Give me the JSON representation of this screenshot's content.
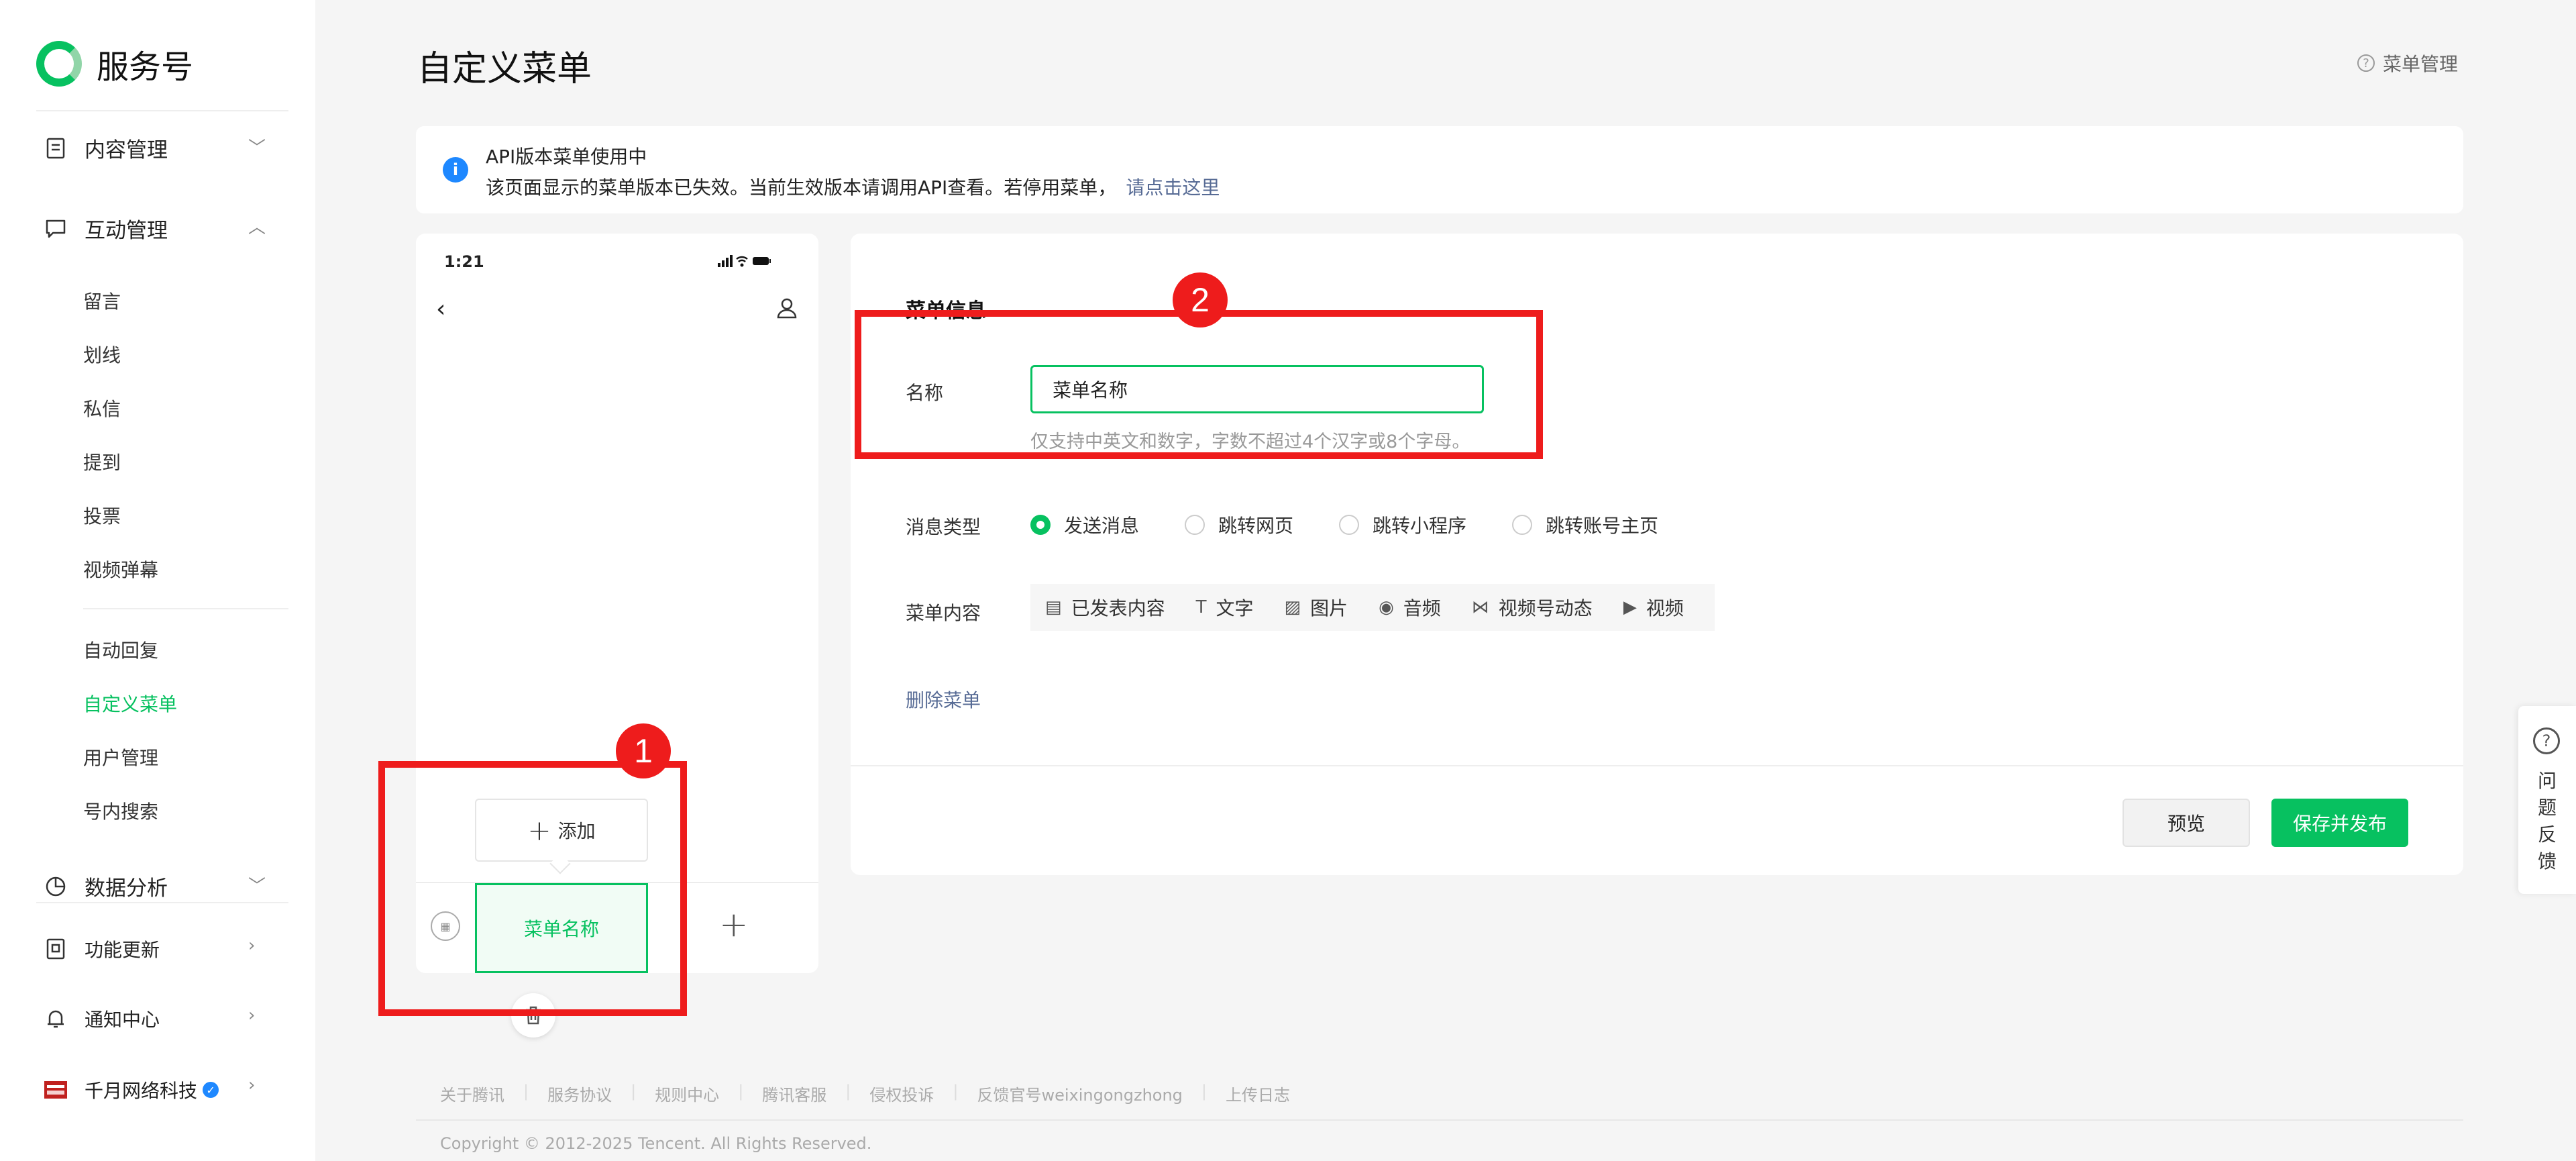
{
  "brand": {
    "name": "服务号"
  },
  "sidebar": {
    "content_mgmt": "内容管理",
    "interaction": "互动管理",
    "interaction_items": [
      "留言",
      "划线",
      "私信",
      "提到",
      "投票",
      "视频弹幕"
    ],
    "reply_items": [
      "自动回复",
      "自定义菜单",
      "用户管理",
      "号内搜索"
    ],
    "active_item": "自定义菜单",
    "data_analysis": "数据分析",
    "feature_updates": "功能更新",
    "notifications": "通知中心",
    "account_name": "千月网络科技"
  },
  "header": {
    "title": "自定义菜单",
    "help_label": "菜单管理"
  },
  "banner": {
    "title": "API版本菜单使用中",
    "text": "该页面显示的菜单版本已失效。当前生效版本请调用API查看。若停用菜单，",
    "link": "请点击这里"
  },
  "phone": {
    "time": "1:21",
    "add_label": "添加",
    "menu_label": "菜单名称"
  },
  "form": {
    "section_title": "菜单信息",
    "name_label": "名称",
    "name_value": "菜单名称",
    "name_hint": "仅支持中英文和数字，字数不超过4个汉字或8个字母。",
    "msg_type_label": "消息类型",
    "msg_types": [
      "发送消息",
      "跳转网页",
      "跳转小程序",
      "跳转账号主页"
    ],
    "selected_msg_type": "发送消息",
    "content_label": "菜单内容",
    "content_types": [
      "已发表内容",
      "文字",
      "图片",
      "音频",
      "视频号动态",
      "视频"
    ],
    "delete_label": "删除菜单",
    "preview_label": "预览",
    "publish_label": "保存并发布"
  },
  "feedback": {
    "label": "问题反馈"
  },
  "footer": {
    "links": [
      "关于腾讯",
      "服务协议",
      "规则中心",
      "腾讯客服",
      "侵权投诉",
      "反馈官号weixingongzhong",
      "上传日志"
    ],
    "copyright": "Copyright © 2012-2025 Tencent. All Rights Reserved."
  },
  "annotations": {
    "badge1": "1",
    "badge2": "2"
  },
  "colors": {
    "accent": "#07c160",
    "link": "#576b95",
    "annotation": "#ee1c1c"
  }
}
